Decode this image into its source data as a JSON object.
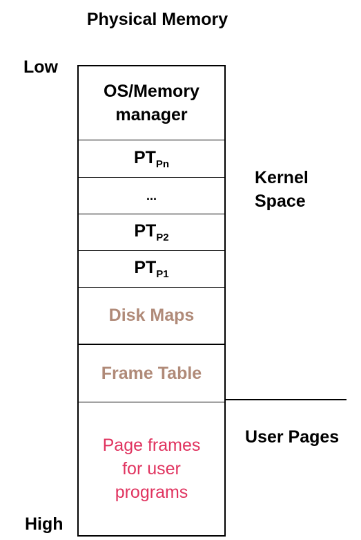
{
  "title": "Physical Memory",
  "edges": {
    "low": "Low",
    "high": "High"
  },
  "segments": {
    "os_line1": "OS/Memory",
    "os_line2": "manager",
    "pt_pn": {
      "base": "PT",
      "sub": "Pn"
    },
    "ellipsis": "...",
    "pt_p2": {
      "base": "PT",
      "sub": "P2"
    },
    "pt_p1": {
      "base": "PT",
      "sub": "P1"
    },
    "disk_maps": "Disk Maps",
    "frame_table": "Frame Table",
    "user_line1": "Page frames",
    "user_line2": "for user",
    "user_line3": "programs"
  },
  "regions": {
    "kernel_line1": "Kernel",
    "kernel_line2": "Space",
    "user": "User Pages"
  },
  "colors": {
    "brown": "#b08a78",
    "pink": "#e0335f"
  }
}
